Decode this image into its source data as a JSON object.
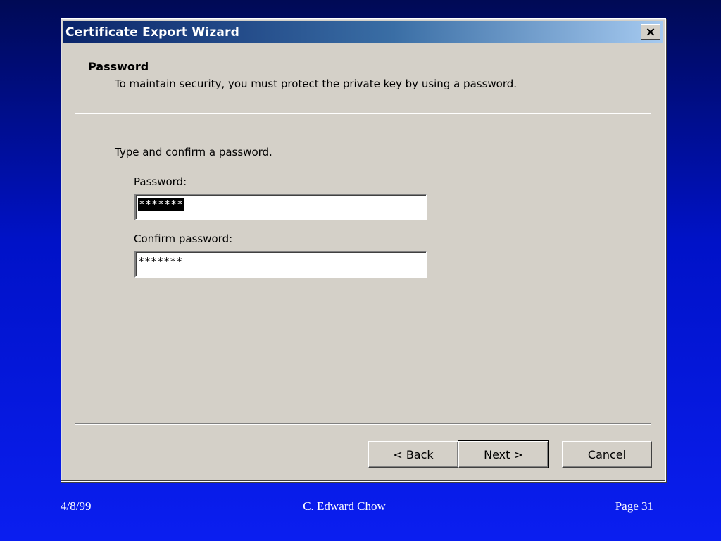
{
  "window": {
    "title": "Certificate Export Wizard",
    "close_label": "×"
  },
  "header": {
    "title": "Password",
    "subtitle": "To maintain security, you must protect the private key by using a password."
  },
  "body": {
    "instruction": "Type and confirm a password.",
    "password_label": "Password:",
    "password_value": "*******",
    "confirm_label": "Confirm password:",
    "confirm_value": "*******"
  },
  "buttons": {
    "back": "< Back",
    "next": "Next >",
    "cancel": "Cancel"
  },
  "footer": {
    "date": "4/8/99",
    "author": "C. Edward Chow",
    "page": "Page  31"
  },
  "colors": {
    "background": "#0012c8",
    "dialog": "#d4d0c8",
    "titlebar_start": "#0a246a",
    "titlebar_end": "#a6caf0"
  },
  "icons": {
    "close": "close-icon"
  }
}
